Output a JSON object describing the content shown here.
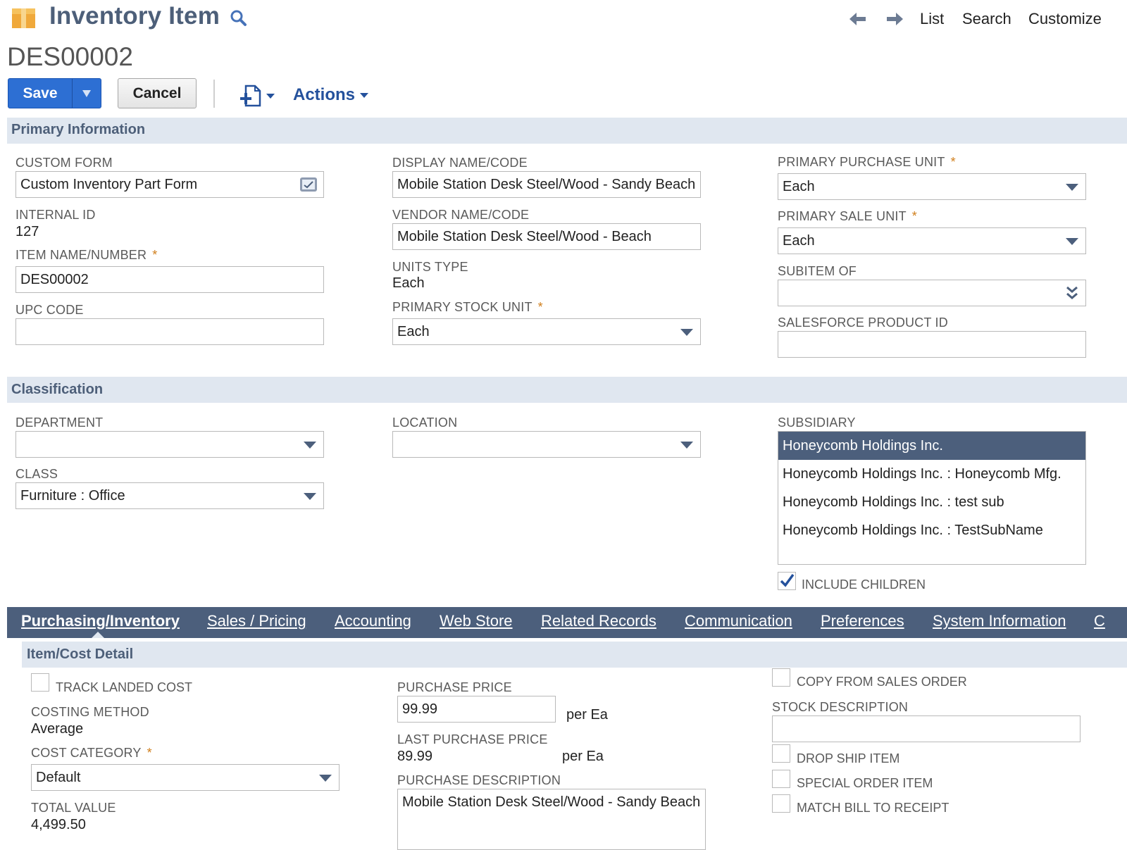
{
  "header": {
    "title": "Inventory Item",
    "record_id": "DES00002",
    "nav_links": [
      "List",
      "Search",
      "Customize"
    ]
  },
  "toolbar": {
    "save_label": "Save",
    "cancel_label": "Cancel",
    "actions_label": "Actions"
  },
  "primary": {
    "section_title": "Primary Information",
    "custom_form_label": "CUSTOM FORM",
    "custom_form_value": "Custom Inventory Part Form",
    "internal_id_label": "INTERNAL ID",
    "internal_id_value": "127",
    "item_name_label": "ITEM NAME/NUMBER",
    "item_name_value": "DES00002",
    "upc_label": "UPC CODE",
    "upc_value": "",
    "display_name_label": "DISPLAY NAME/CODE",
    "display_name_value": "Mobile Station Desk Steel/Wood - Sandy Beach",
    "vendor_name_label": "VENDOR NAME/CODE",
    "vendor_name_value": "Mobile Station Desk Steel/Wood - Beach",
    "units_type_label": "UNITS TYPE",
    "units_type_value": "Each",
    "primary_stock_unit_label": "PRIMARY STOCK UNIT",
    "primary_stock_unit_value": "Each",
    "primary_purchase_unit_label": "PRIMARY PURCHASE UNIT",
    "primary_purchase_unit_value": "Each",
    "primary_sale_unit_label": "PRIMARY SALE UNIT",
    "primary_sale_unit_value": "Each",
    "subitem_of_label": "SUBITEM OF",
    "subitem_of_value": "",
    "salesforce_id_label": "SALESFORCE PRODUCT ID",
    "salesforce_id_value": "",
    "required_mark": "*"
  },
  "classification": {
    "section_title": "Classification",
    "department_label": "DEPARTMENT",
    "department_value": "",
    "class_label": "CLASS",
    "class_value": "Furniture : Office",
    "location_label": "LOCATION",
    "location_value": "",
    "subsidiary_label": "SUBSIDIARY",
    "subsidiary_options": [
      {
        "label": "Honeycomb Holdings Inc.",
        "selected": true
      },
      {
        "label": "Honeycomb Holdings Inc. : Honeycomb Mfg.",
        "selected": false
      },
      {
        "label": "Honeycomb Holdings Inc. : test sub",
        "selected": false
      },
      {
        "label": "Honeycomb Holdings Inc. : TestSubName",
        "selected": false
      }
    ],
    "include_children_label": "INCLUDE CHILDREN",
    "include_children_checked": true
  },
  "tabs": [
    {
      "label": "Purchasing/Inventory",
      "active": true
    },
    {
      "label": "Sales / Pricing",
      "active": false
    },
    {
      "label": "Accounting",
      "active": false
    },
    {
      "label": "Web Store",
      "active": false
    },
    {
      "label": "Related Records",
      "active": false
    },
    {
      "label": "Communication",
      "active": false
    },
    {
      "label": "Preferences",
      "active": false
    },
    {
      "label": "System Information",
      "active": false
    },
    {
      "label": "C",
      "active": false
    }
  ],
  "cost_detail": {
    "section_title": "Item/Cost Detail",
    "track_landed_cost_label": "TRACK LANDED COST",
    "costing_method_label": "COSTING METHOD",
    "costing_method_value": "Average",
    "cost_category_label": "COST CATEGORY",
    "cost_category_value": "Default",
    "total_value_label": "TOTAL VALUE",
    "total_value_value": "4,499.50",
    "purchase_price_label": "PURCHASE PRICE",
    "purchase_price_value": "99.99",
    "per_unit": "per Ea",
    "last_purchase_price_label": "LAST PURCHASE PRICE",
    "last_purchase_price_value": "89.99",
    "purchase_description_label": "PURCHASE DESCRIPTION",
    "purchase_description_value": "Mobile Station Desk Steel/Wood - Sandy Beach",
    "copy_from_sales_order_label": "COPY FROM SALES ORDER",
    "stock_description_label": "STOCK DESCRIPTION",
    "stock_description_value": "",
    "drop_ship_label": "DROP SHIP ITEM",
    "special_order_label": "SPECIAL ORDER ITEM",
    "match_bill_label": "MATCH BILL TO RECEIPT"
  },
  "colors": {
    "title": "#4d5f79",
    "section_bar": "#e0e7f0",
    "tab_bar": "#4c5f7c",
    "save_button": "#2d6fd3",
    "required": "#d07e1b",
    "link": "#24519c"
  },
  "icons": [
    "inventory-box-icon",
    "search-icon",
    "back-arrow-icon",
    "forward-arrow-icon",
    "new-record-icon",
    "list-icon",
    "dropdown-arrow-icon",
    "double-chevron-icon",
    "checkmark-icon"
  ]
}
